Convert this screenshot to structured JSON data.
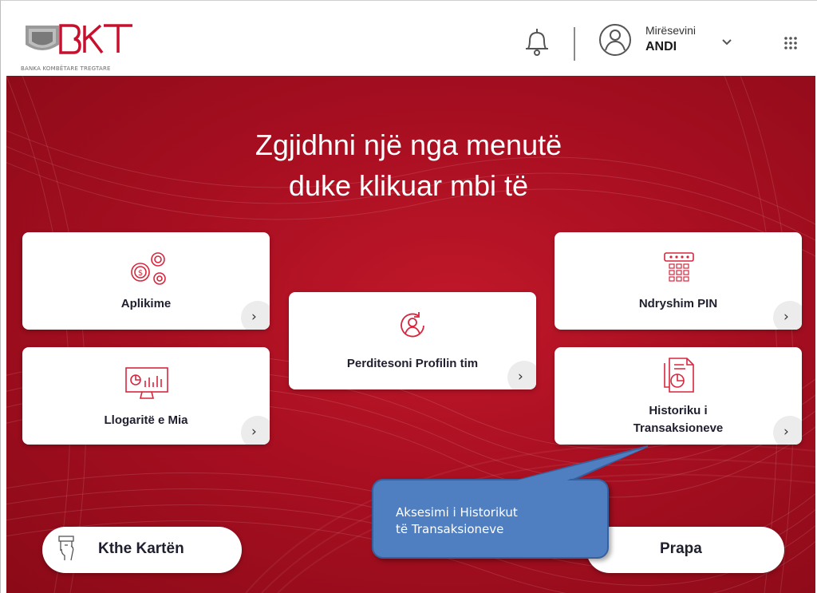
{
  "header": {
    "logo_text": "BKT",
    "logo_subtitle": "BANKA KOMBËTARE TREGTARE",
    "greeting": "Mirësevini",
    "user_name": "ANDI"
  },
  "main": {
    "title_line1": "Zgjidhni një nga menutë",
    "title_line2": "duke klikuar mbi të"
  },
  "tiles": {
    "aplikime": "Aplikime",
    "llogarite": "Llogaritë e Mia",
    "profili": "Perditesoni Profilin tim",
    "pin": "Ndryshim PIN",
    "historiku_line1": "Historiku i",
    "historiku_line2": "Transaksioneve",
    "arrow": "›"
  },
  "buttons": {
    "return_card": "Kthe Kartën",
    "back": "Prapa"
  },
  "callout": {
    "line1": "Aksesimi i Historikut",
    "line2": "të Transaksioneve"
  },
  "colors": {
    "brand_red": "#b3152a",
    "callout_blue": "#4f7fc1",
    "icon_red": "#d7263d"
  }
}
